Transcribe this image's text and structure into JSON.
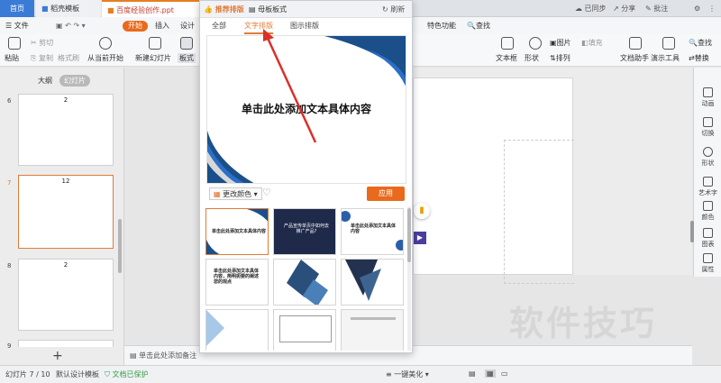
{
  "titlebar": {
    "home_tab": "首页",
    "template_tab": "稻壳模板",
    "doc_tab": "百度经验创作.ppt",
    "sync": "已同步",
    "share": "分享",
    "comment": "批注"
  },
  "menu": {
    "file": "文件",
    "start": "开始",
    "insert": "插入",
    "design": "设计",
    "special": "特色功能",
    "search": "查找"
  },
  "ribbon": {
    "paste": "粘贴",
    "cut": "剪切",
    "copy": "复制",
    "format_painter": "格式刷",
    "from_current": "从当前开始",
    "new_slide": "新建幻灯片",
    "layout": "板式",
    "textbox": "文本框",
    "shape": "形状",
    "picture": "图片",
    "arrange": "排列",
    "fill": "填充",
    "text_assist": "文档助手",
    "present_tool": "演示工具",
    "find": "查找",
    "replace": "替换"
  },
  "leftpanel": {
    "outline_tab": "大纲",
    "slides_tab": "幻灯片",
    "slides": [
      {
        "num": "6",
        "label": "2"
      },
      {
        "num": "7",
        "label": "12"
      },
      {
        "num": "8",
        "label": "2"
      },
      {
        "num": "9",
        "label": ""
      }
    ],
    "add": "+"
  },
  "popup": {
    "recommend": "推荐排版",
    "master": "母板板式",
    "refresh": "刷新",
    "tabs": [
      "全部",
      "文字排版",
      "图示排版"
    ],
    "preview_title": "单击此处添加文本具体内容",
    "change_color": "更改颜色",
    "apply": "应用",
    "grid": [
      "单击此处添加文本具体内容",
      "产品宣传单页中如何去推广产品?",
      "单击此处添加文本具体内容",
      "单击此处添加文本具体内容，简明扼要的阐述您的观点",
      "",
      "",
      "",
      "",
      ""
    ]
  },
  "rail": [
    "动画",
    "切换",
    "形状",
    "艺术字",
    "颜色",
    "图表",
    "属性"
  ],
  "notes": {
    "placeholder": "单击此处添加备注"
  },
  "status": {
    "slide_info": "幻灯片 7 / 10",
    "template": "默认设计模板",
    "protect": "文档已保护",
    "beautify": "一键美化"
  },
  "watermark": "软件技巧",
  "colors": {
    "accent": "#e96a1d",
    "brand_blue": "#3a7bd5",
    "dark_blue": "#1a4f8a"
  }
}
